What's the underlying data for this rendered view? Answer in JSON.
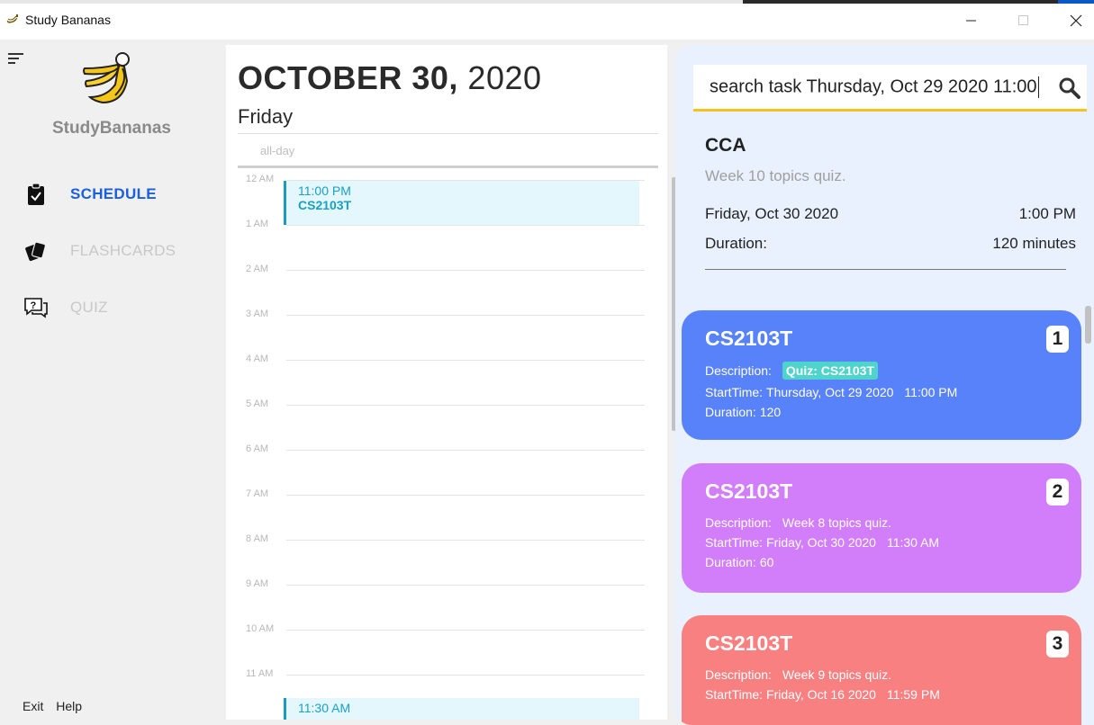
{
  "window": {
    "title": "Study Bananas"
  },
  "sidebar": {
    "brand": "StudyBananas",
    "items": [
      {
        "label": "SCHEDULE",
        "icon": "clipboard-check-icon",
        "active": true
      },
      {
        "label": "FLASHCARDS",
        "icon": "flashcards-icon",
        "active": false
      },
      {
        "label": "QUIZ",
        "icon": "quiz-chat-icon",
        "active": false
      }
    ],
    "footer": {
      "exit": "Exit",
      "help": "Help"
    }
  },
  "calendar": {
    "month_day": "OCTOBER 30,",
    "year": "2020",
    "weekday": "Friday",
    "allday_label": "all-day",
    "hours": [
      "12 AM",
      "1 AM",
      "2 AM",
      "3 AM",
      "4 AM",
      "5 AM",
      "6 AM",
      "7 AM",
      "8 AM",
      "9 AM",
      "10 AM",
      "11 AM"
    ],
    "events": [
      {
        "time": "11:00 PM",
        "name": "CS2103T"
      },
      {
        "time": "11:30 AM",
        "name": ""
      }
    ]
  },
  "search": {
    "value": "search task Thursday, Oct 29 2020 11:00"
  },
  "detail": {
    "title": "CCA",
    "description": "Week 10 topics quiz.",
    "date": "Friday, Oct 30 2020",
    "time": "1:00 PM",
    "duration_label": "Duration:",
    "duration_value": "120 minutes"
  },
  "tasks": [
    {
      "index": "1",
      "title": "CS2103T",
      "desc_label": "Description:",
      "desc": "Quiz: CS2103T",
      "start_label": "StartTime:",
      "start_date": "Thursday, Oct 29 2020",
      "start_time": "11:00 PM",
      "duration_label": "Duration:",
      "duration": "120",
      "color": "#5882fa"
    },
    {
      "index": "2",
      "title": "CS2103T",
      "desc_label": "Description:",
      "desc": "Week 8 topics quiz.",
      "start_label": "StartTime:",
      "start_date": "Friday, Oct 30 2020",
      "start_time": "11:30 AM",
      "duration_label": "Duration:",
      "duration": "60",
      "color": "#d27efb"
    },
    {
      "index": "3",
      "title": "CS2103T",
      "desc_label": "Description:",
      "desc": "Week 9 topics quiz.",
      "start_label": "StartTime:",
      "start_date": "Friday, Oct 16 2020",
      "start_time": "11:59 PM",
      "duration_label": "Duration:",
      "duration": "",
      "color": "#f98080"
    }
  ]
}
